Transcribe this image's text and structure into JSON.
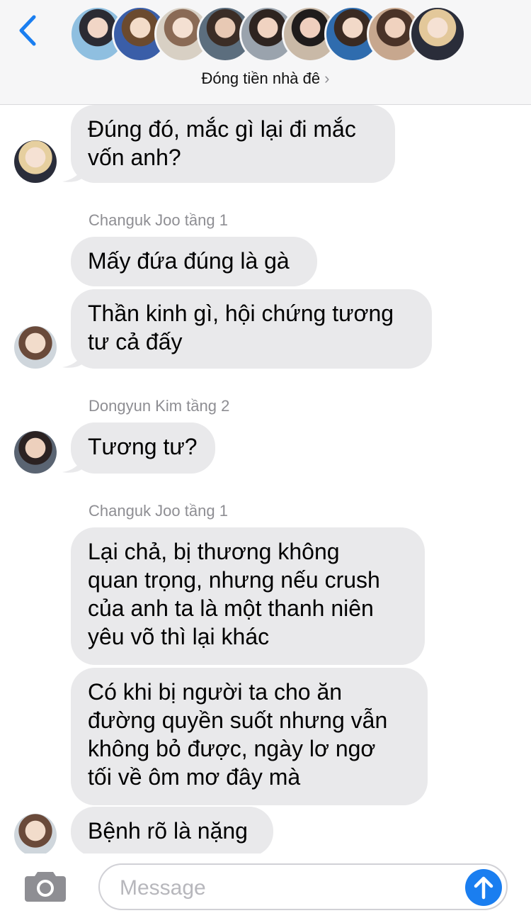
{
  "header": {
    "back_icon": "chevron-left-icon",
    "group_name": "Đóng tiền nhà đê",
    "group_chevron": "›",
    "member_avatars": 9,
    "accent": "#1a7ef0"
  },
  "messages": [
    {
      "text": "Đúng đó, mắc gì lại đi mắc\nvốn anh?"
    },
    {
      "sender": "Changuk Joo tầng 1"
    },
    {
      "text": "Mấy đứa đúng là gà"
    },
    {
      "text": "Thần kinh gì, hội chứng tương\ntư cả đấy"
    },
    {
      "sender": "Dongyun Kim tầng 2"
    },
    {
      "text": "Tương tư?"
    },
    {
      "sender": "Changuk Joo tầng 1"
    },
    {
      "text": "Lại chả, bị thương không\nquan trọng, nhưng nếu crush\ncủa anh ta là một thanh niên\nyêu võ thì lại khác"
    },
    {
      "text": "Có khi bị người ta cho ăn\nđường quyền suốt nhưng vẫn\nkhông bỏ được, ngày lơ ngơ\ntối về ôm mơ đây mà"
    },
    {
      "text": "Bệnh rõ là nặng"
    }
  ],
  "compose": {
    "placeholder": "Message",
    "camera_icon": "camera-icon",
    "send_icon": "arrow-up-icon"
  }
}
